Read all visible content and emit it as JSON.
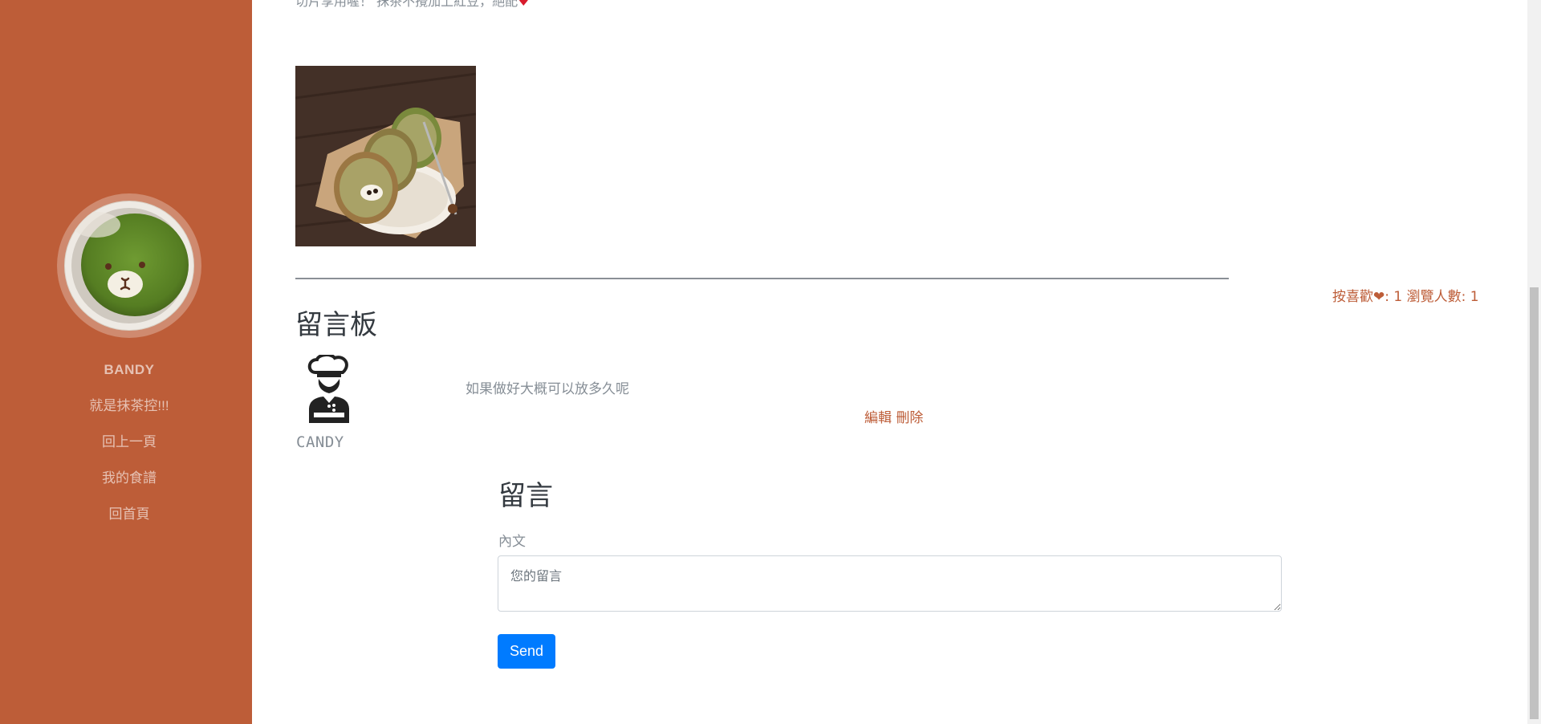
{
  "sidebar": {
    "brand": "BANDY",
    "items": [
      {
        "label": "就是抹茶控!!!"
      },
      {
        "label": "回上一頁"
      },
      {
        "label": "我的食譜"
      },
      {
        "label": "回首頁"
      }
    ]
  },
  "post": {
    "truncated_text": "切片享用喔！ 抹茶不攪加上紅豆，絕配",
    "heart": "♥",
    "image_alt": "抹茶紅豆蛋糕捲"
  },
  "stats": {
    "text": "按喜歡❤: 1 瀏覽人數: 1"
  },
  "message_board": {
    "title": "留言板",
    "comments": [
      {
        "author": "CANDY",
        "body": "如果做好大概可以放多久呢",
        "edit": "編輯",
        "delete": "刪除"
      }
    ]
  },
  "form": {
    "title": "留言",
    "field_label": "內文",
    "placeholder": "您的留言",
    "value": "",
    "send": "Send"
  },
  "colors": {
    "sidebar": "#bd5d38",
    "accent": "#bd5d38",
    "button": "#007bff"
  }
}
